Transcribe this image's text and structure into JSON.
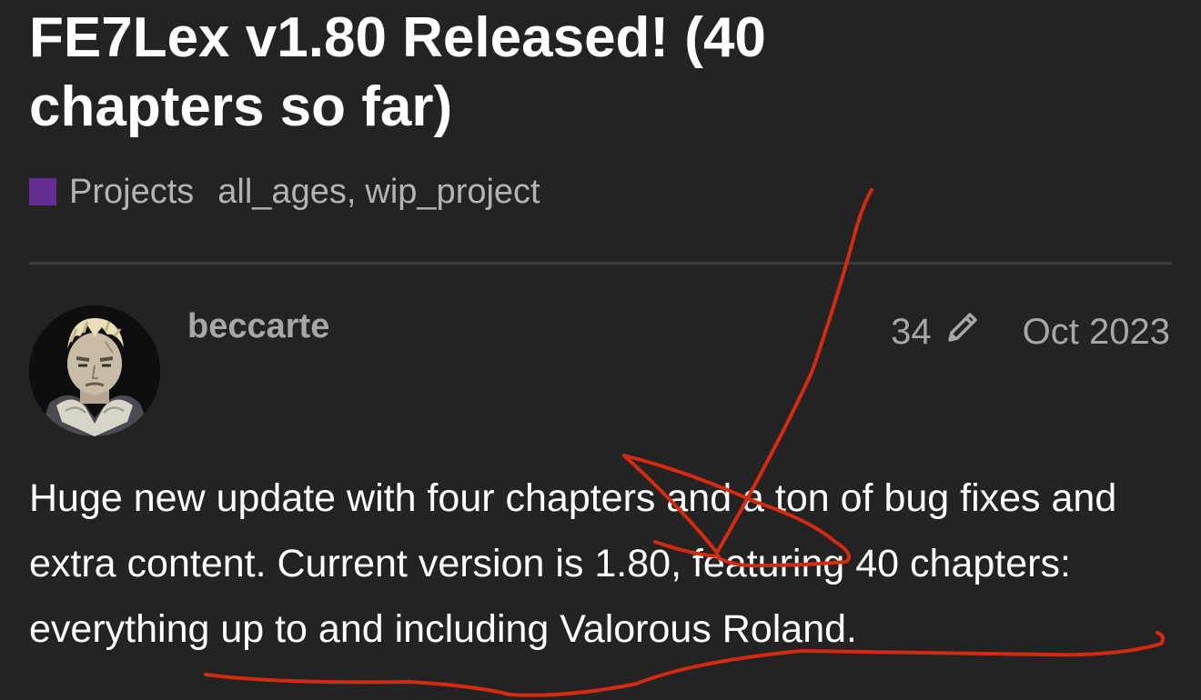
{
  "topic": {
    "title": "FE7Lex v1.80 Released! (40 chapters so far)",
    "category": {
      "name": "Projects",
      "color": "#652d90"
    },
    "tags": [
      "all_ages",
      "wip_project"
    ]
  },
  "post": {
    "author": "beccarte",
    "edit_count": "34",
    "edit_icon": "pencil-icon",
    "date": "Oct 2023",
    "body": "Huge new update with four chapters and a ton of bug fixes and extra content. Current version is 1.80, featuring 40 chapters: everything up to and including Valorous Roland."
  },
  "annotation": {
    "color": "#d42a10"
  }
}
